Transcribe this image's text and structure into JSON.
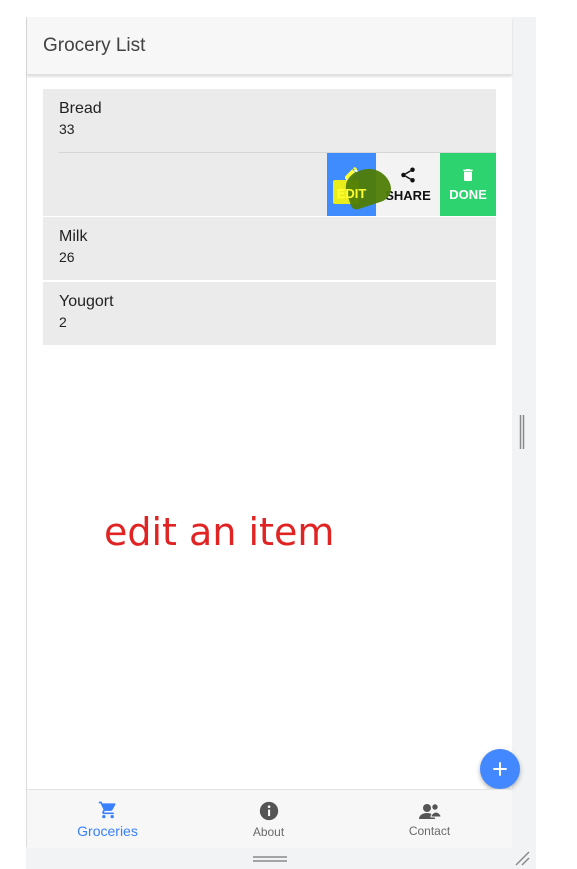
{
  "header": {
    "title": "Grocery List"
  },
  "items": [
    {
      "name": "Bread",
      "quantity": "33"
    },
    {
      "name": "Milk",
      "quantity": "26"
    },
    {
      "name": "Yougort",
      "quantity": "2"
    }
  ],
  "item_actions": {
    "edit_label": "EDIT",
    "share_label": "SHARE",
    "done_label": "DONE",
    "edit_icon": "pencil-icon",
    "share_icon": "share-icon",
    "done_icon": "trash-icon"
  },
  "annotation": {
    "text": "edit an item"
  },
  "fab": {
    "icon": "plus-icon"
  },
  "tabs": [
    {
      "label": "Groceries",
      "icon": "cart-icon",
      "active": true
    },
    {
      "label": "About",
      "icon": "info-icon",
      "active": false
    },
    {
      "label": "Contact",
      "icon": "people-icon",
      "active": false
    }
  ],
  "colors": {
    "primary": "#3880ff",
    "edit": "#3f8cff",
    "done": "#2dd36f",
    "annotation": "#e02424",
    "highlight_yellow": "#f2f20f",
    "highlight_green": "#4f7d06"
  }
}
